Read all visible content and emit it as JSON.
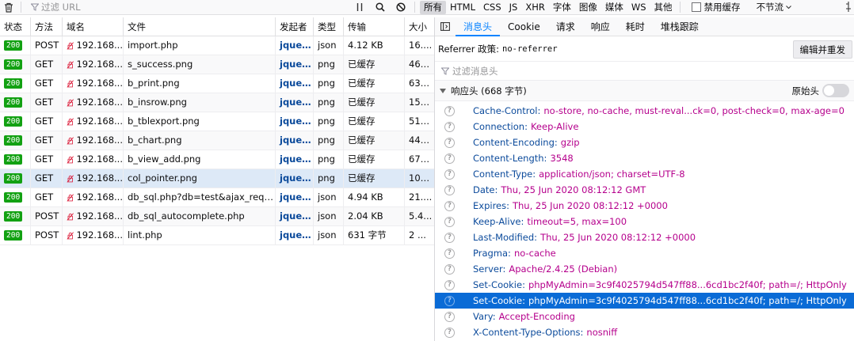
{
  "toolbar": {
    "filter_placeholder": "过滤 URL",
    "type_filters": [
      "所有",
      "HTML",
      "CSS",
      "JS",
      "XHR",
      "字体",
      "图像",
      "媒体",
      "WS",
      "其他"
    ],
    "active_filter": "所有",
    "disable_cache_label": "禁用缓存",
    "throttle_label": "不节流"
  },
  "table": {
    "columns": [
      "状态",
      "方法",
      "域名",
      "文件",
      "发起者",
      "类型",
      "传输",
      "大小"
    ],
    "rows": [
      {
        "status": "200",
        "method": "POST",
        "domain": "192.168...",
        "file": "import.php",
        "initiator": "jquer...",
        "type": "json",
        "transfer": "4.12 KB",
        "size": "16...."
      },
      {
        "status": "200",
        "method": "GET",
        "domain": "192.168...",
        "file": "s_success.png",
        "initiator": "jquer...",
        "type": "png",
        "transfer": "已缓存",
        "size": "465..."
      },
      {
        "status": "200",
        "method": "GET",
        "domain": "192.168...",
        "file": "b_print.png",
        "initiator": "jquer...",
        "type": "png",
        "transfer": "已缓存",
        "size": "639..."
      },
      {
        "status": "200",
        "method": "GET",
        "domain": "192.168...",
        "file": "b_insrow.png",
        "initiator": "jquer...",
        "type": "png",
        "transfer": "已缓存",
        "size": "157..."
      },
      {
        "status": "200",
        "method": "GET",
        "domain": "192.168...",
        "file": "b_tblexport.png",
        "initiator": "jquer...",
        "type": "png",
        "transfer": "已缓存",
        "size": "514..."
      },
      {
        "status": "200",
        "method": "GET",
        "domain": "192.168...",
        "file": "b_chart.png",
        "initiator": "jquer...",
        "type": "png",
        "transfer": "已缓存",
        "size": "449..."
      },
      {
        "status": "200",
        "method": "GET",
        "domain": "192.168...",
        "file": "b_view_add.png",
        "initiator": "jquer...",
        "type": "png",
        "transfer": "已缓存",
        "size": "678..."
      },
      {
        "status": "200",
        "method": "GET",
        "domain": "192.168...",
        "file": "col_pointer.png",
        "initiator": "jquer...",
        "type": "png",
        "transfer": "已缓存",
        "size": "102..."
      },
      {
        "status": "200",
        "method": "GET",
        "domain": "192.168...",
        "file": "db_sql.php?db=test&ajax_reque...",
        "initiator": "jquer...",
        "type": "json",
        "transfer": "4.94 KB",
        "size": "21...."
      },
      {
        "status": "200",
        "method": "POST",
        "domain": "192.168...",
        "file": "db_sql_autocomplete.php",
        "initiator": "jquer...",
        "type": "json",
        "transfer": "2.04 KB",
        "size": "5.4..."
      },
      {
        "status": "200",
        "method": "POST",
        "domain": "192.168...",
        "file": "lint.php",
        "initiator": "jquer...",
        "type": "json",
        "transfer": "631 字节",
        "size": "2 ..."
      }
    ]
  },
  "details": {
    "tabs": [
      "消息头",
      "Cookie",
      "请求",
      "响应",
      "耗时",
      "堆栈跟踪"
    ],
    "active_tab": "消息头",
    "referrer_label": "Referrer 政策:",
    "referrer_value": "no-referrer",
    "resend_label": "编辑并重发",
    "filter_placeholder": "过滤消息头",
    "response_headers_title": "响应头 (668 字节)",
    "raw_label": "原始头",
    "headers": [
      {
        "name": "Cache-Control:",
        "value": "no-store, no-cache, must-reval...ck=0, post-check=0, max-age=0"
      },
      {
        "name": "Connection:",
        "value": "Keep-Alive"
      },
      {
        "name": "Content-Encoding:",
        "value": "gzip"
      },
      {
        "name": "Content-Length:",
        "value": "3548"
      },
      {
        "name": "Content-Type:",
        "value": "application/json; charset=UTF-8"
      },
      {
        "name": "Date:",
        "value": "Thu, 25 Jun 2020 08:12:12 GMT"
      },
      {
        "name": "Expires:",
        "value": "Thu, 25 Jun 2020 08:12:12 +0000"
      },
      {
        "name": "Keep-Alive:",
        "value": "timeout=5, max=100"
      },
      {
        "name": "Last-Modified:",
        "value": "Thu, 25 Jun 2020 08:12:12 +0000"
      },
      {
        "name": "Pragma:",
        "value": "no-cache"
      },
      {
        "name": "Server:",
        "value": "Apache/2.4.25 (Debian)"
      },
      {
        "name": "Set-Cookie:",
        "value": "phpMyAdmin=3c9f4025794d547ff88...6cd1bc2f40f; path=/; HttpOnly"
      },
      {
        "name": "Set-Cookie:",
        "value": "phpMyAdmin=3c9f4025794d547ff88...6cd1bc2f40f; path=/; HttpOnly"
      },
      {
        "name": "Vary:",
        "value": "Accept-Encoding"
      },
      {
        "name": "X-Content-Type-Options:",
        "value": "nosniff"
      }
    ]
  }
}
